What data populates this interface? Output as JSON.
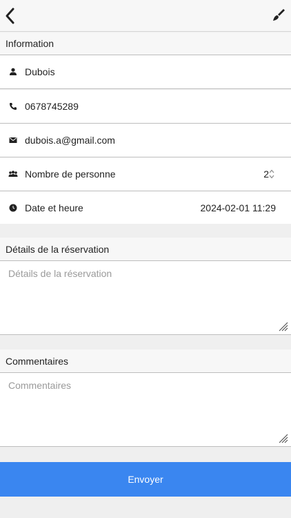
{
  "header": {
    "back_icon": "chevron-left-icon",
    "clear_icon": "paintbrush-icon"
  },
  "info": {
    "title": "Information",
    "name": {
      "icon": "user-icon",
      "value": "Dubois"
    },
    "phone": {
      "icon": "phone-icon",
      "value": "0678745289"
    },
    "email": {
      "icon": "envelope-icon",
      "value": "dubois.a@gmail.com"
    },
    "people": {
      "icon": "group-icon",
      "label": "Nombre de personne",
      "value": "2"
    },
    "datetime": {
      "icon": "clock-icon",
      "label": "Date et heure",
      "value": "2024-02-01 11:29"
    }
  },
  "details": {
    "title": "Détails de la réservation",
    "placeholder": "Détails de la réservation",
    "value": ""
  },
  "comments": {
    "title": "Commentaires",
    "placeholder": "Commentaires",
    "value": ""
  },
  "submit": {
    "label": "Envoyer",
    "color": "#3a86f0"
  }
}
